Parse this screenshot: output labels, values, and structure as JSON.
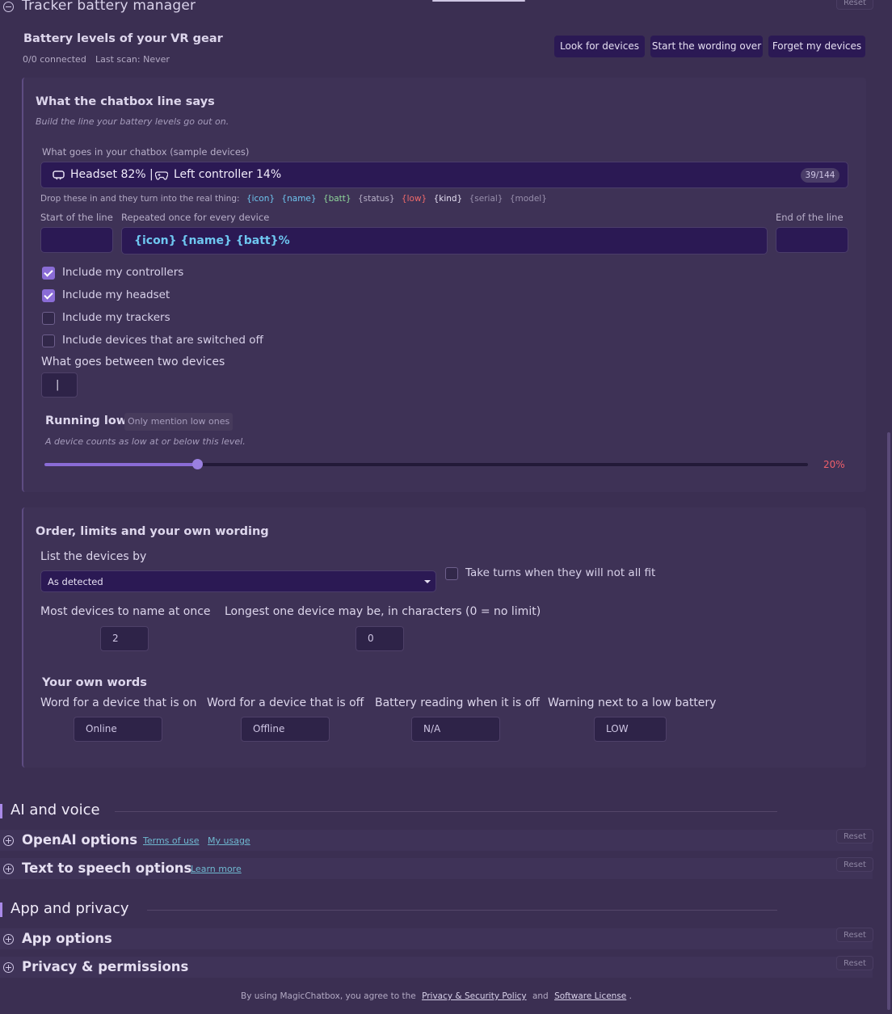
{
  "tracker": {
    "title": "Tracker battery manager",
    "reset": "Reset",
    "battery_heading": "Battery levels of your VR gear",
    "connected": "0/0 connected",
    "last_scan": "Last scan: Never",
    "buttons": {
      "look": "Look for devices",
      "restart": "Start the wording over",
      "forget": "Forget my devices"
    }
  },
  "chatbox_card": {
    "title": "What the chatbox line says",
    "subtitle": "Build the line your battery levels go out on.",
    "preview_label": "What goes in your chatbox (sample devices)",
    "preview_part1": "Headset 82% |",
    "preview_part2": "Left controller 14%",
    "preview_count": "39/144",
    "tokens_label": "Drop these in and they turn into the real thing:",
    "tokens": {
      "icon": "{icon}",
      "name": "{name}",
      "batt": "{batt}",
      "status": "{status}",
      "low": "{low}",
      "kind": "{kind}",
      "serial": "{serial}",
      "model": "{model}"
    },
    "start_label": "Start of the line",
    "repeat_label": "Repeated once for every device",
    "end_label": "End of the line",
    "template_value": "{icon} {name} {batt}%",
    "checks": {
      "controllers": "Include my controllers",
      "headset": "Include my headset",
      "trackers": "Include my trackers",
      "off": "Include devices that are switched off"
    },
    "separator_label": "What goes between two devices",
    "separator_value": "|",
    "low_title": "Running low",
    "low_badge": "Only mention low ones",
    "low_sub": "A device counts as low at or below this level.",
    "low_value": "20%",
    "low_fraction": 0.2
  },
  "order_card": {
    "title": "Order, limits and your own wording",
    "list_by_label": "List the devices by",
    "list_by_value": "As detected",
    "take_turns": "Take turns when they will not all fit",
    "most_label": "Most devices to name at once",
    "most_value": "2",
    "longest_label": "Longest one device may be, in characters (0 = no limit)",
    "longest_value": "0",
    "own_words_title": "Your own words",
    "on_label": "Word for a device that is on",
    "on_value": "Online",
    "off_label": "Word for a device that is off",
    "off_value": "Offline",
    "reading_label": "Battery reading when it is off",
    "reading_value": "N/A",
    "warning_label": "Warning next to a low battery",
    "warning_value": "LOW"
  },
  "ai_section": {
    "title": "AI and voice",
    "openai": "OpenAI options",
    "terms": "Terms of use",
    "usage": "My usage",
    "tts": "Text to speech options",
    "learn": "Learn more",
    "reset": "Reset"
  },
  "app_section": {
    "title": "App and privacy",
    "app_options": "App options",
    "privacy": "Privacy & permissions",
    "reset": "Reset"
  },
  "footer": {
    "prefix": "By using MagicChatbox, you agree to the",
    "policy": "Privacy & Security Policy",
    "and": "and",
    "license": "Software License",
    "suffix": "."
  },
  "colors": {
    "background": "#3b2f52",
    "accent": "#8a6cd6",
    "button": "#2b1954",
    "low_value": "#ef5f6a",
    "token_blue": "#6ec6f0",
    "token_green": "#8fd69a",
    "token_red": "#f06a6a",
    "link": "#6fb8d0"
  }
}
